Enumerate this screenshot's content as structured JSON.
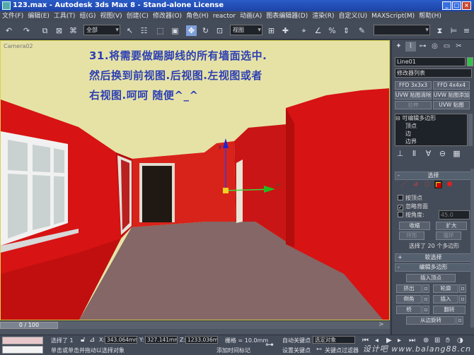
{
  "window": {
    "title": "123.max - Autodesk 3ds Max 8 - Stand-alone License"
  },
  "menu": [
    "文件(F)",
    "编辑(E)",
    "工具(T)",
    "组(G)",
    "视图(V)",
    "创建(C)",
    "修改器(O)",
    "角色(H)",
    "reactor",
    "动画(A)",
    "图表编辑器(D)",
    "渲染(R)",
    "自定义(U)",
    "MAXScript(M)",
    "帮助(H)"
  ],
  "toolbar": {
    "selection_filter": "全部",
    "reference_coord": "视图"
  },
  "viewport": {
    "label": "Camera02",
    "note_lines": [
      "31.将需要做踢脚线的所有墙面选中.",
      "然后换到前视图.后视图.左视图或者",
      "右视图.呵呵 随便^_^"
    ],
    "gizmo": {
      "axis_y": "y",
      "axis_x": "x"
    },
    "colors": {
      "wall": "#d71313",
      "ceiling": "#e6e2a6",
      "floor": "#846766",
      "window": "#f1f1f1"
    }
  },
  "panel": {
    "object_name": "Line01",
    "modifier_list": "修改器列表",
    "modifier_buttons": [
      "FFD 3x3x3",
      "FFD 4x4x4",
      "UVW 贴图清除",
      "UVW 贴图添加",
      "拉伸",
      "UVW 贴图"
    ],
    "stack": [
      "可编辑多边形",
      "顶点",
      "边",
      "边界"
    ],
    "selection": {
      "title": "选择",
      "by_vertex": "按顶点",
      "ignore_backfacing": "忽略背面",
      "by_angle": "按角度:",
      "angle_value": "45.0",
      "shrink": "收缩",
      "grow": "扩大",
      "ring": "环形",
      "loop": "循环",
      "selected_count": "选择了 20 个多边形"
    },
    "soft_selection": "软选择",
    "edit_polygons": {
      "title": "编辑多边形",
      "insert_vertex": "插入顶点",
      "buttons": [
        "挤出",
        "轮廓",
        "倒角",
        "插入",
        "桥",
        "翻转"
      ],
      "hinge": "从边旋转"
    }
  },
  "timeline": {
    "frame": "0 / 100"
  },
  "status": {
    "selected": "选择了 1",
    "x_label": "X:",
    "x_value": "343.064mm",
    "y_label": "Y:",
    "y_value": "327.141mm",
    "z_label": "Z:",
    "z_value": "1233.036m",
    "grid": "栅格 = 10.0mm",
    "auto_key": "自动关键点",
    "selected_object": "选定对象",
    "prompt": "单击或单击并拖动以选择对象",
    "add_time_tag": "添加时间标记",
    "set_key": "设置关键点",
    "key_filters": "关键点过滤器"
  },
  "watermark": "设计吧 www.balang88.cn"
}
